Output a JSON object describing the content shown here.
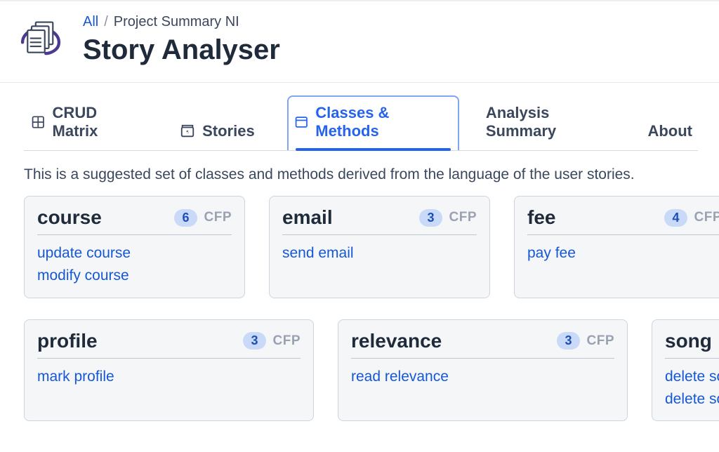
{
  "breadcrumb": {
    "root": "All",
    "separator": "/",
    "current": "Project Summary NI"
  },
  "page_title": "Story Analyser",
  "tabs": [
    {
      "id": "crud",
      "label": "CRUD Matrix",
      "icon": "grid-icon",
      "active": false
    },
    {
      "id": "stories",
      "label": "Stories",
      "icon": "stories-icon",
      "active": false
    },
    {
      "id": "classes",
      "label": "Classes & Methods",
      "icon": "window-icon",
      "active": true
    },
    {
      "id": "summary",
      "label": "Analysis Summary",
      "icon": null,
      "active": false
    },
    {
      "id": "about",
      "label": "About",
      "icon": null,
      "active": false
    }
  ],
  "description": "This is a suggested set of classes and methods derived from the language of the user stories.",
  "cfp_label": "CFP",
  "cards_row1": [
    {
      "name": "course",
      "cfp": 6,
      "methods": [
        "update course",
        "modify course"
      ]
    },
    {
      "name": "email",
      "cfp": 3,
      "methods": [
        "send email"
      ]
    },
    {
      "name": "fee",
      "cfp": 4,
      "methods": [
        "pay fee"
      ]
    }
  ],
  "cards_row2": [
    {
      "name": "profile",
      "cfp": 3,
      "methods": [
        "mark profile"
      ]
    },
    {
      "name": "relevance",
      "cfp": 3,
      "methods": [
        "read relevance"
      ]
    },
    {
      "name": "song",
      "cfp": null,
      "methods": [
        "delete so",
        "delete so"
      ]
    }
  ]
}
